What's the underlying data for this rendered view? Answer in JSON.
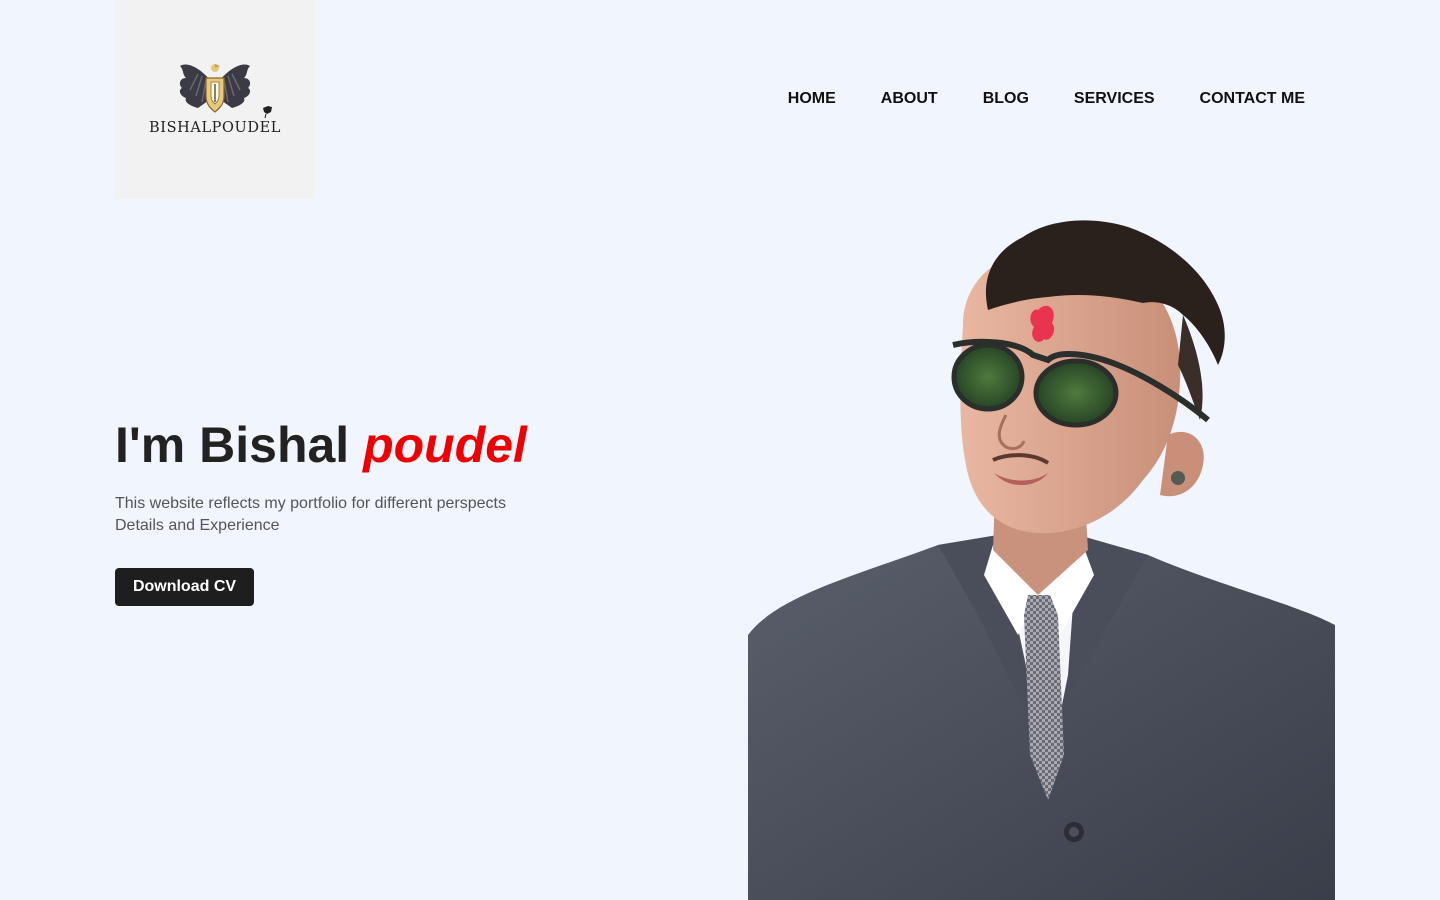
{
  "brand": {
    "logo_text": "BISHALPOUDEL",
    "icon": "eagle-wings-crest-icon"
  },
  "nav": {
    "items": [
      {
        "label": "HOME"
      },
      {
        "label": "ABOUT"
      },
      {
        "label": "BLOG"
      },
      {
        "label": "SERVICES"
      },
      {
        "label": "CONTACT ME"
      }
    ]
  },
  "hero": {
    "title_prefix": "I'm Bishal ",
    "title_accent": "poudel",
    "description_line1": "This website reflects my portfolio for different perspects",
    "description_line2": "Details and Experience",
    "cta_label": "Download CV"
  },
  "colors": {
    "background": "#f0f5fe",
    "accent": "#ee0000",
    "button_bg": "#1e1e1e",
    "text_dark": "#222222",
    "text_muted": "#555555"
  }
}
